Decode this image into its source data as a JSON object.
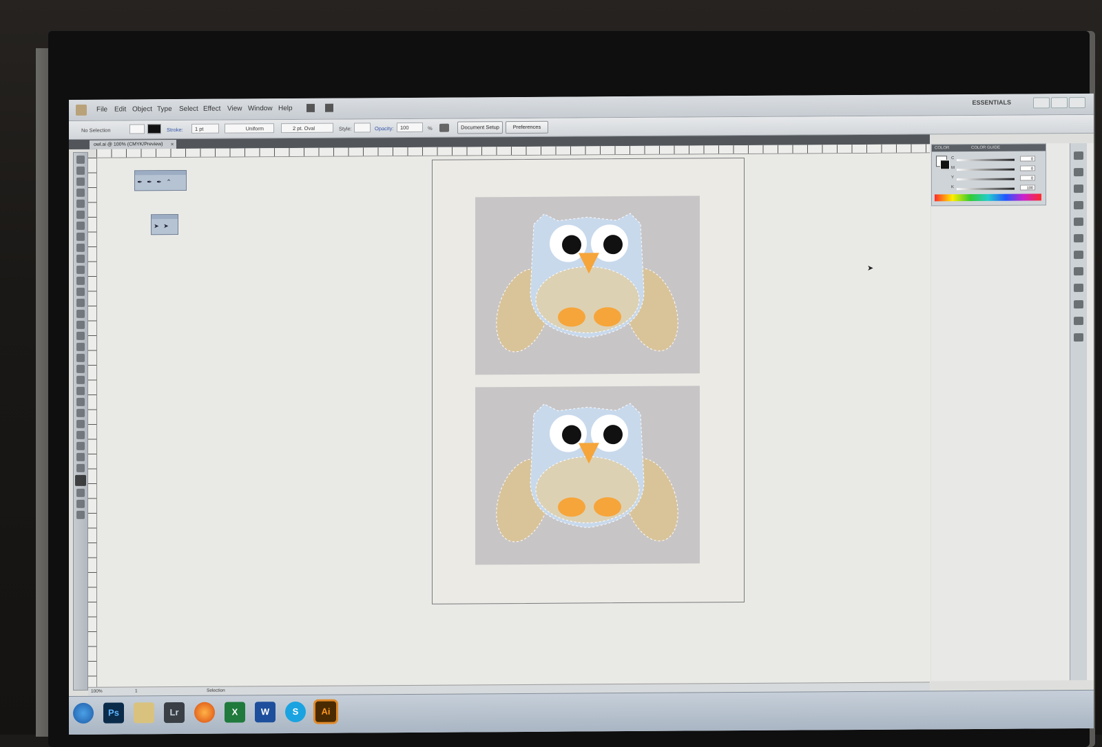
{
  "menubar": {
    "items": [
      "File",
      "Edit",
      "Object",
      "Type",
      "Select",
      "Effect",
      "View",
      "Window",
      "Help"
    ],
    "workspace": "ESSENTIALS"
  },
  "control_bar": {
    "selection": "No Selection",
    "stroke_label": "Stroke:",
    "stroke_weight": "1 pt",
    "stroke_profile": "Uniform",
    "brush": "2 pt. Oval",
    "style_label": "Style:",
    "opacity_label": "Opacity:",
    "opacity_value": "100",
    "opacity_unit": "%",
    "document_setup": "Document Setup",
    "preferences": "Preferences"
  },
  "document": {
    "tab_title": "owl.ai @ 100% (CMYK/Preview)",
    "close_glyph": "×"
  },
  "color_panel": {
    "tabs": [
      "COLOR",
      "COLOR GUIDE"
    ],
    "channels": [
      {
        "label": "C",
        "value": "0"
      },
      {
        "label": "M",
        "value": "0"
      },
      {
        "label": "Y",
        "value": "0"
      },
      {
        "label": "K",
        "value": "100"
      }
    ],
    "percent": "%"
  },
  "statusbar": {
    "zoom": "100%",
    "page": "1",
    "tool": "Selection"
  },
  "taskbar": {
    "apps": [
      {
        "name": "start",
        "label": ""
      },
      {
        "name": "photoshop",
        "label": "Ps"
      },
      {
        "name": "explorer",
        "label": ""
      },
      {
        "name": "lightroom",
        "label": "Lr"
      },
      {
        "name": "firefox",
        "label": ""
      },
      {
        "name": "excel",
        "label": "X"
      },
      {
        "name": "word",
        "label": "W"
      },
      {
        "name": "skype",
        "label": "S"
      },
      {
        "name": "illustrator",
        "label": "Ai"
      }
    ]
  },
  "colors": {
    "photo_bg": "#c8c5c7",
    "owl_body": "#c8d9ec",
    "owl_wing": "#d9c49a",
    "owl_beak": "#f6a53a"
  }
}
